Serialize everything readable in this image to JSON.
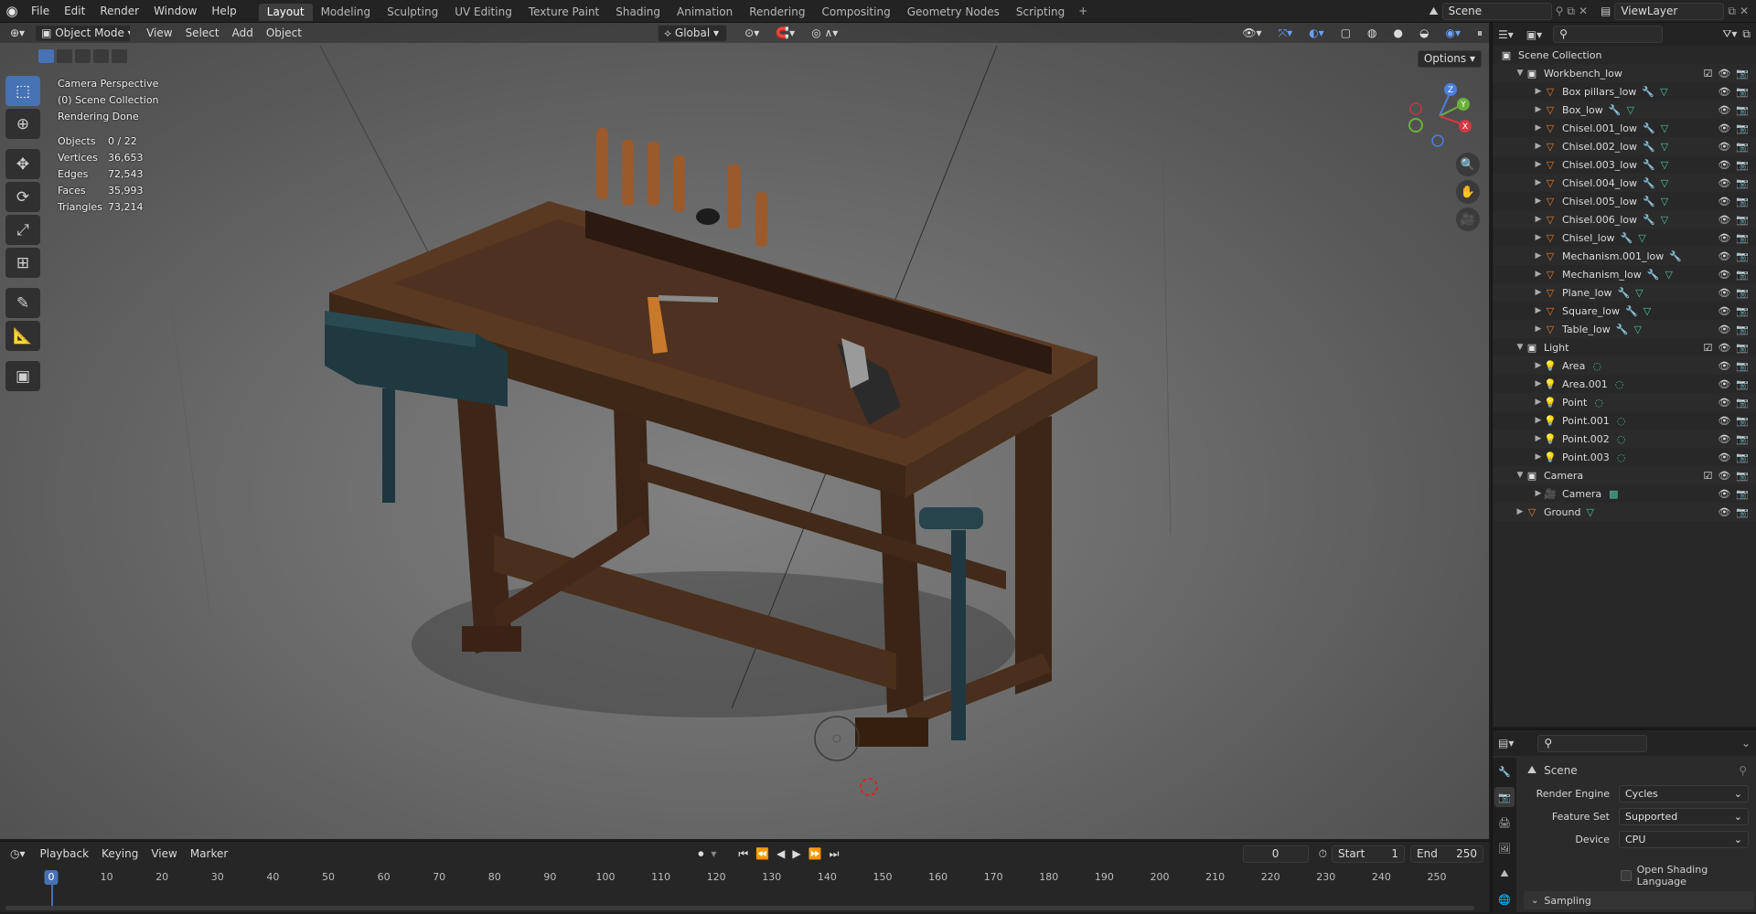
{
  "menu": [
    "File",
    "Edit",
    "Render",
    "Window",
    "Help"
  ],
  "workspaces": [
    {
      "label": "Layout",
      "active": true
    },
    {
      "label": "Modeling"
    },
    {
      "label": "Sculpting"
    },
    {
      "label": "UV Editing"
    },
    {
      "label": "Texture Paint"
    },
    {
      "label": "Shading"
    },
    {
      "label": "Animation"
    },
    {
      "label": "Rendering"
    },
    {
      "label": "Compositing"
    },
    {
      "label": "Geometry Nodes"
    },
    {
      "label": "Scripting"
    }
  ],
  "scene_field": "Scene",
  "viewlayer_field": "ViewLayer",
  "viewport": {
    "mode": "Object Mode",
    "menu": [
      "View",
      "Select",
      "Add",
      "Object"
    ],
    "transform_orientation": "Global",
    "options_label": "Options",
    "info": [
      "Camera Perspective",
      "(0) Scene Collection",
      "Rendering Done"
    ],
    "stats": [
      {
        "k": "Objects",
        "v": "0 / 22"
      },
      {
        "k": "Vertices",
        "v": "36,653"
      },
      {
        "k": "Edges",
        "v": "72,543"
      },
      {
        "k": "Faces",
        "v": "35,993"
      },
      {
        "k": "Triangles",
        "v": "73,214"
      }
    ],
    "gizmo_axes": {
      "x": "X",
      "y": "Y",
      "z": "Z"
    }
  },
  "outliner": {
    "root": "Scene Collection",
    "rows": [
      {
        "label": "Workbench_low",
        "kind": "collection",
        "level": 0,
        "expanded": true,
        "checkbox": true
      },
      {
        "label": "Box pillars_low",
        "kind": "mesh",
        "level": 1,
        "mod": true,
        "mesh": true
      },
      {
        "label": "Box_low",
        "kind": "mesh",
        "level": 1,
        "mod": true,
        "mesh": true
      },
      {
        "label": "Chisel.001_low",
        "kind": "mesh",
        "level": 1,
        "mod": true,
        "mesh": true
      },
      {
        "label": "Chisel.002_low",
        "kind": "mesh",
        "level": 1,
        "mod": true,
        "mesh": true
      },
      {
        "label": "Chisel.003_low",
        "kind": "mesh",
        "level": 1,
        "mod": true,
        "mesh": true
      },
      {
        "label": "Chisel.004_low",
        "kind": "mesh",
        "level": 1,
        "mod": true,
        "mesh": true
      },
      {
        "label": "Chisel.005_low",
        "kind": "mesh",
        "level": 1,
        "mod": true,
        "mesh": true
      },
      {
        "label": "Chisel.006_low",
        "kind": "mesh",
        "level": 1,
        "mod": true,
        "mesh": true
      },
      {
        "label": "Chisel_low",
        "kind": "mesh",
        "level": 1,
        "mod": true,
        "mesh": true
      },
      {
        "label": "Mechanism.001_low",
        "kind": "mesh",
        "level": 1,
        "mod": true,
        "mesh": false
      },
      {
        "label": "Mechanism_low",
        "kind": "mesh",
        "level": 1,
        "mod": true,
        "mesh": true
      },
      {
        "label": "Plane_low",
        "kind": "mesh",
        "level": 1,
        "mod": true,
        "mesh": true
      },
      {
        "label": "Square_low",
        "kind": "mesh",
        "level": 1,
        "mod": true,
        "mesh": true
      },
      {
        "label": "Table_low",
        "kind": "mesh",
        "level": 1,
        "mod": true,
        "mesh": true
      },
      {
        "label": "Light",
        "kind": "collection",
        "level": 0,
        "expanded": true,
        "checkbox": true
      },
      {
        "label": "Area",
        "kind": "light",
        "level": 1
      },
      {
        "label": "Area.001",
        "kind": "light",
        "level": 1
      },
      {
        "label": "Point",
        "kind": "light",
        "level": 1
      },
      {
        "label": "Point.001",
        "kind": "light",
        "level": 1
      },
      {
        "label": "Point.002",
        "kind": "light",
        "level": 1
      },
      {
        "label": "Point.003",
        "kind": "light",
        "level": 1
      },
      {
        "label": "Camera",
        "kind": "collection",
        "level": 0,
        "expanded": true,
        "checkbox": true
      },
      {
        "label": "Camera",
        "kind": "camera",
        "level": 1
      },
      {
        "label": "Ground",
        "kind": "ground",
        "level": 0
      }
    ]
  },
  "properties": {
    "context": "Scene",
    "rows": [
      {
        "label": "Render Engine",
        "value": "Cycles"
      },
      {
        "label": "Feature Set",
        "value": "Supported"
      },
      {
        "label": "Device",
        "value": "CPU"
      }
    ],
    "checkbox_label": "Open Shading Language",
    "panel": "Sampling"
  },
  "timeline": {
    "menu": [
      "Playback",
      "Keying",
      "View",
      "Marker"
    ],
    "current_frame": "0",
    "start_label": "Start",
    "start": "1",
    "end_label": "End",
    "end": "250",
    "ticks": [
      "0",
      "10",
      "20",
      "30",
      "40",
      "50",
      "60",
      "70",
      "80",
      "90",
      "100",
      "110",
      "120",
      "130",
      "140",
      "150",
      "160",
      "170",
      "180",
      "190",
      "200",
      "210",
      "220",
      "230",
      "240",
      "250"
    ]
  },
  "colors": {
    "accent": "#4772b3",
    "collection": "#e4e4e4",
    "mesh": "#e87c2c",
    "light": "#e39b4e",
    "camera": "#7fc7b0"
  }
}
